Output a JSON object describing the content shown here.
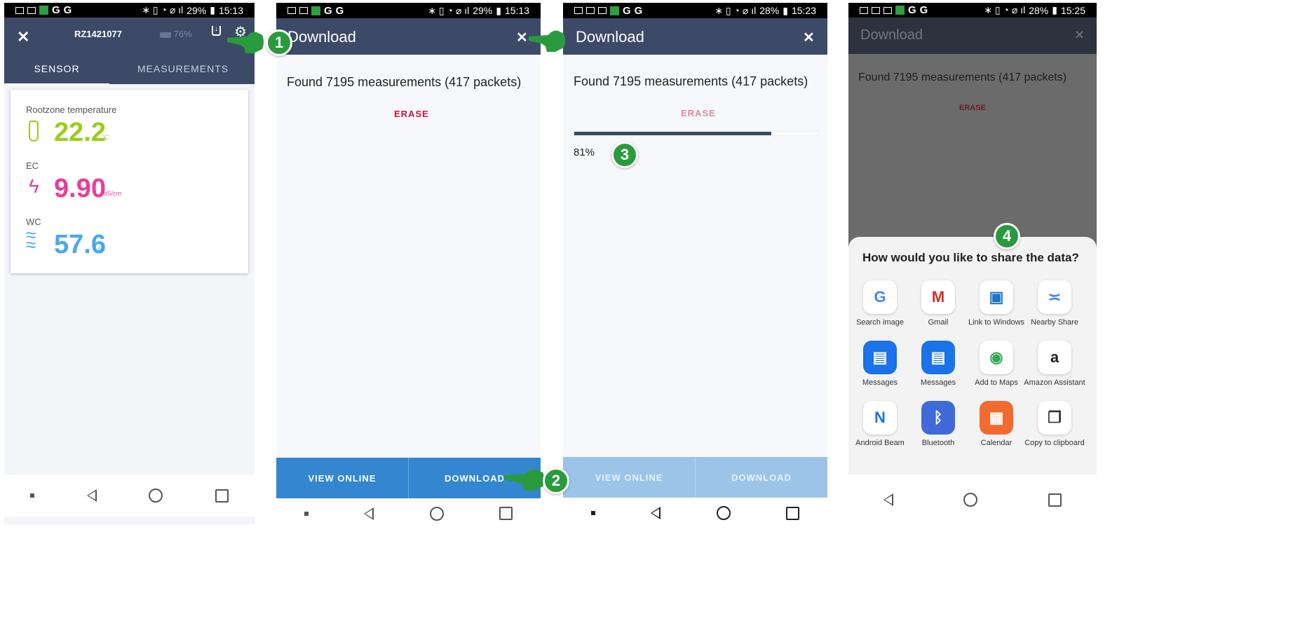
{
  "status": {
    "p1": {
      "battery": "29%",
      "time": "15:13"
    },
    "p2": {
      "battery": "29%",
      "time": "15:13"
    },
    "p3": {
      "battery": "28%",
      "time": "15:23"
    },
    "p4": {
      "battery": "28%",
      "time": "15:25"
    }
  },
  "screen1": {
    "device_id": "RZ1421077",
    "battery": "76%",
    "tabs": [
      "SENSOR",
      "MEASUREMENTS"
    ],
    "metrics": [
      {
        "label": "Rootzone temperature",
        "value": "22.2",
        "unit": "°C",
        "color": "#9ccc1b"
      },
      {
        "label": "EC",
        "value": "9.90",
        "unit": "mS/cm",
        "color": "#e83e9c"
      },
      {
        "label": "WC",
        "value": "57.6",
        "unit": "%",
        "color": "#4aa9e9"
      }
    ]
  },
  "screen2": {
    "title": "Download",
    "found": "Found 7195 measurements (417 packets)",
    "erase": "ERASE",
    "view_online": "VIEW ONLINE",
    "download": "DOWNLOAD"
  },
  "screen3": {
    "title": "Download",
    "found": "Found 7195 measurements (417 packets)",
    "erase": "ERASE",
    "progress": 0.81,
    "progress_label": "81%",
    "view_online": "VIEW ONLINE",
    "download": "DOWNLOAD"
  },
  "screen4": {
    "title": "Download",
    "found": "Found 7195 measurements (417 packets)",
    "erase": "ERASE",
    "share_title": "How would you like to share the data?",
    "share_items": [
      {
        "label": "Search image",
        "icon": "google-icon"
      },
      {
        "label": "Gmail",
        "icon": "gmail-icon"
      },
      {
        "label": "Link to Windows",
        "icon": "link-to-windows-icon"
      },
      {
        "label": "Nearby Share",
        "icon": "nearby-share-icon"
      },
      {
        "label": "Messages",
        "icon": "messages-icon"
      },
      {
        "label": "Messages",
        "icon": "messages-icon"
      },
      {
        "label": "Add to Maps",
        "icon": "maps-icon"
      },
      {
        "label": "Amazon Assistant",
        "icon": "amazon-icon"
      },
      {
        "label": "Android Beam",
        "icon": "android-beam-icon"
      },
      {
        "label": "Bluetooth",
        "icon": "bluetooth-icon"
      },
      {
        "label": "Calendar",
        "icon": "calendar-icon"
      },
      {
        "label": "Copy to clipboard",
        "icon": "copy-icon"
      }
    ]
  },
  "steps": [
    "1",
    "2",
    "3",
    "4"
  ],
  "colors": {
    "header": "#3c4a68",
    "button_blue": "#3486d1",
    "button_blue_disabled": "#9cc4e8",
    "erase_red": "#c8143c",
    "badge_green": "#2a9a3e"
  }
}
